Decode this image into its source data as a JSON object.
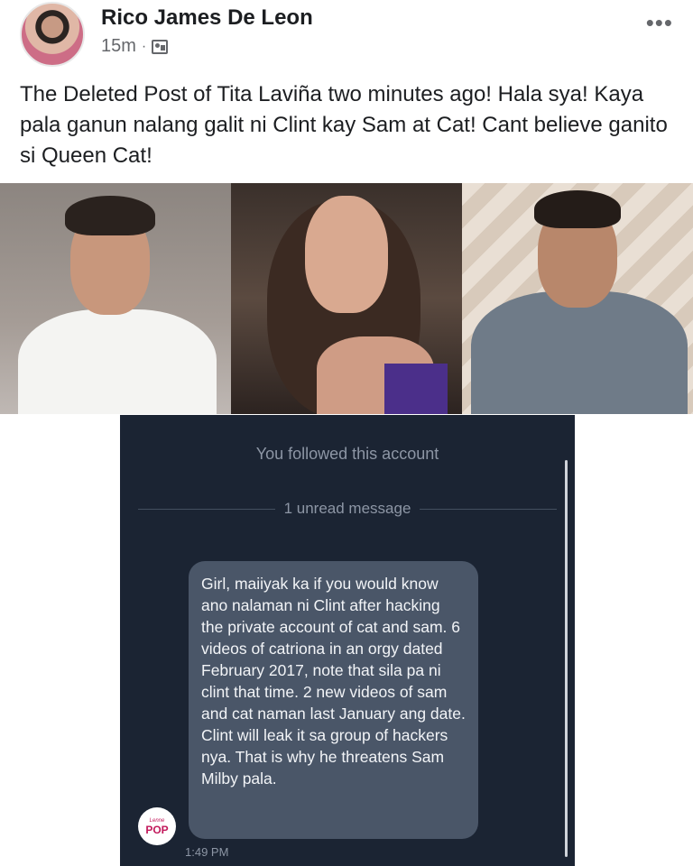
{
  "post": {
    "author": "Rico James De Leon",
    "time": "15m",
    "separator": "·",
    "more_icon": "•••",
    "text": "The Deleted Post of Tita Laviña two minutes ago! Hala sya! Kaya pala ganun nalang galit ni Clint kay Sam at Cat! Cant believe ganito si Queen Cat!"
  },
  "chat": {
    "followed_text": "You followed this account",
    "unread_text": "1 unread message",
    "message": "Girl, maiiyak ka if you would know ano nalaman ni Clint after hacking the private account of cat and sam. 6 videos of catriona in an orgy dated February 2017, note that sila pa ni clint that time. 2 new videos of sam and cat naman last January ang date. Clint will leak it sa group of hackers nya. That is why he threatens Sam Milby pala.",
    "sender_badge": "POP",
    "sender_badge_small": "Lenne",
    "timestamp": "1:49 PM"
  }
}
